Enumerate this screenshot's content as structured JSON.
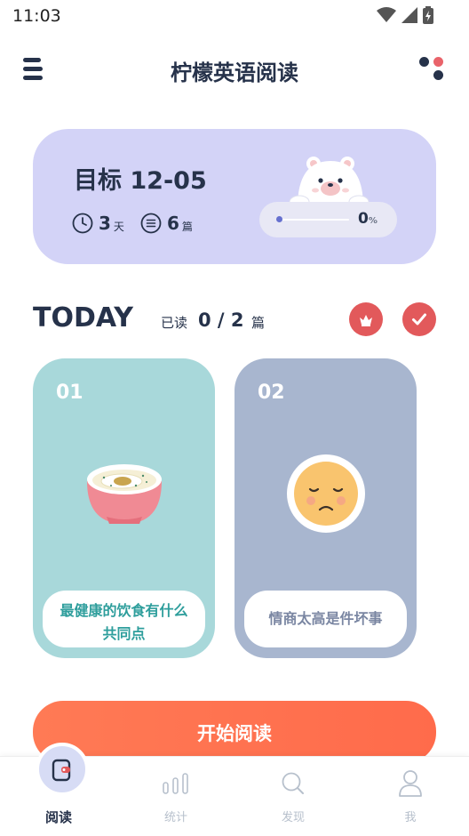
{
  "status_bar": {
    "time": "11:03"
  },
  "header": {
    "title": "柠檬英语阅读"
  },
  "goal": {
    "title": "目标 12-05",
    "days_value": "3",
    "days_unit": "天",
    "articles_value": "6",
    "articles_unit": "篇",
    "progress_value": "0",
    "progress_unit": "%"
  },
  "today": {
    "heading": "TODAY",
    "read_label": "已读",
    "read_count": "0 / 2",
    "read_unit": "篇"
  },
  "cards": [
    {
      "number": "01",
      "title": "最健康的饮食有什么共同点",
      "bg_color": "#a8d8da",
      "text_color": "#2e9e9c"
    },
    {
      "number": "02",
      "title": "情商太高是件坏事",
      "bg_color": "#a8b6cf",
      "text_color": "#7a86a2"
    }
  ],
  "start_button": {
    "label": "开始阅读"
  },
  "tabbar": {
    "tabs": [
      {
        "label": "阅读",
        "icon": "book-icon",
        "active": true
      },
      {
        "label": "统计",
        "icon": "bar-chart-icon",
        "active": false
      },
      {
        "label": "发现",
        "icon": "search-icon",
        "active": false
      },
      {
        "label": "我",
        "icon": "user-icon",
        "active": false
      }
    ]
  },
  "colors": {
    "navy": "#26324a",
    "goal_card_bg": "#d3d3f7",
    "accent_red": "#e2595b",
    "start_orange": "#ff7452",
    "tab_inactive": "#b7c0cc"
  }
}
